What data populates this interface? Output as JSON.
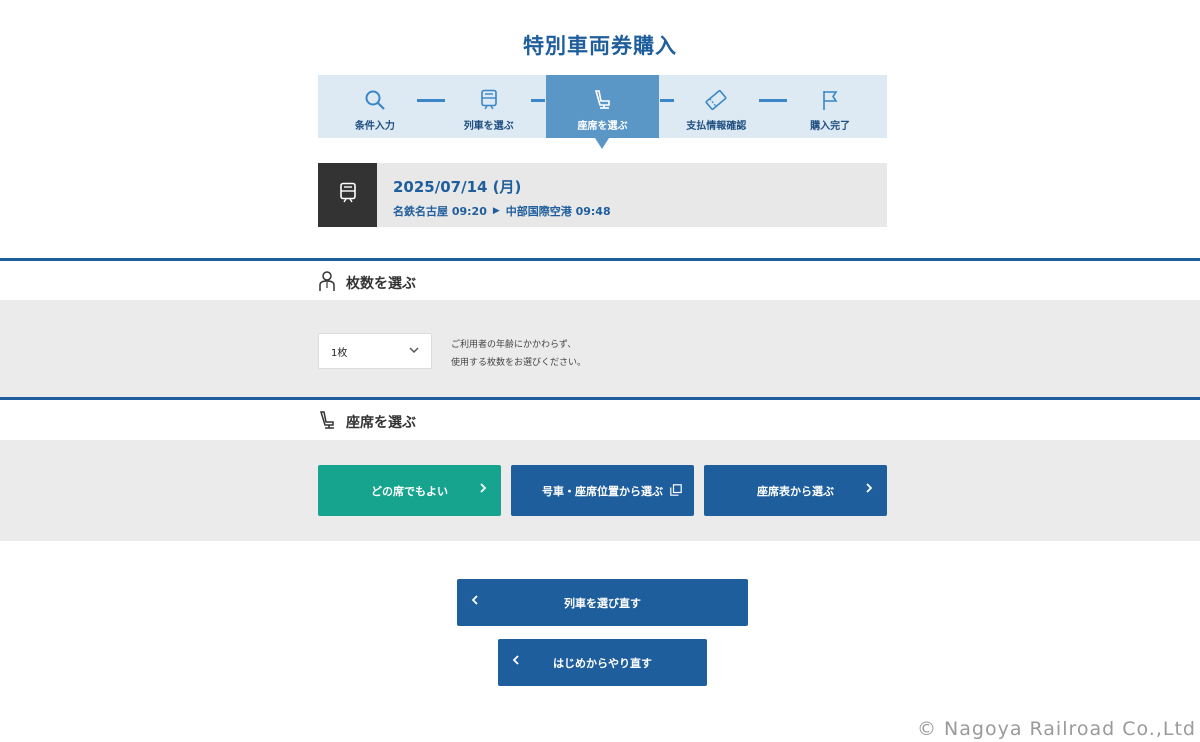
{
  "page": {
    "title": "特別車両券購入"
  },
  "steps": [
    {
      "label": "条件入力",
      "icon": "search-icon",
      "active": false
    },
    {
      "label": "列車を選ぶ",
      "icon": "train-icon",
      "active": false
    },
    {
      "label": "座席を選ぶ",
      "icon": "seat-icon",
      "active": true
    },
    {
      "label": "支払情報確認",
      "icon": "ticket-icon",
      "active": false
    },
    {
      "label": "購入完了",
      "icon": "flag-icon",
      "active": false
    }
  ],
  "train": {
    "date": "2025/07/14 (月)",
    "departure": "名鉄名古屋 09:20",
    "arrival": "中部国際空港 09:48"
  },
  "tickets": {
    "heading": "枚数を選ぶ",
    "selected": "1枚",
    "note_line1": "ご利用者の年齢にかかわらず、",
    "note_line2": "使用する枚数をお選びください。"
  },
  "seats": {
    "heading": "座席を選ぶ",
    "any_seat": "どの席でもよい",
    "by_position": "号車・座席位置から選ぶ",
    "by_map": "座席表から選ぶ"
  },
  "actions": {
    "reselect_train": "列車を選び直す",
    "restart": "はじめからやり直す"
  },
  "footer": {
    "copyright": "© Nagoya Railroad Co.,Ltd"
  },
  "colors": {
    "primary": "#1f5e9c",
    "accent": "#16a48e",
    "step_active": "#5a96c6",
    "step_bg": "#dde9f3"
  }
}
